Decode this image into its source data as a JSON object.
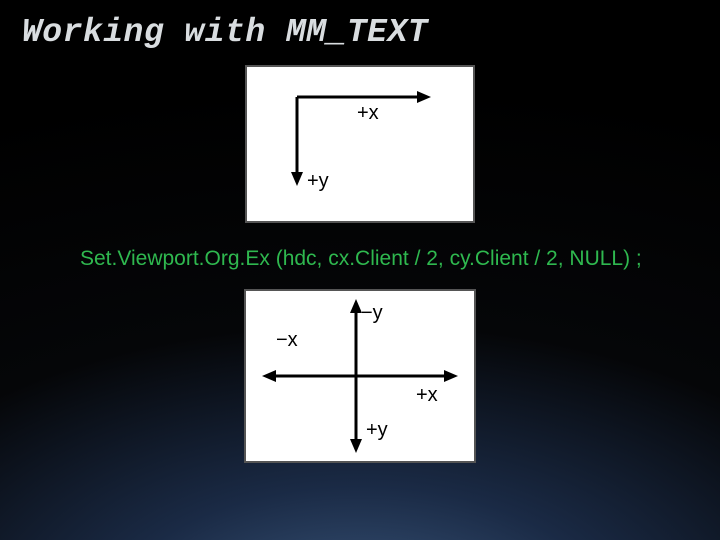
{
  "title": "Working with MM_TEXT",
  "code": "Set.Viewport.Org.Ex (hdc, cx.Client / 2, cy.Client / 2, NULL) ;",
  "fig1": {
    "px_label": "+x",
    "py_label": "+y"
  },
  "fig2": {
    "neg_y": "−y",
    "neg_x": "−x",
    "pos_x": "+x",
    "pos_y": "+y"
  }
}
